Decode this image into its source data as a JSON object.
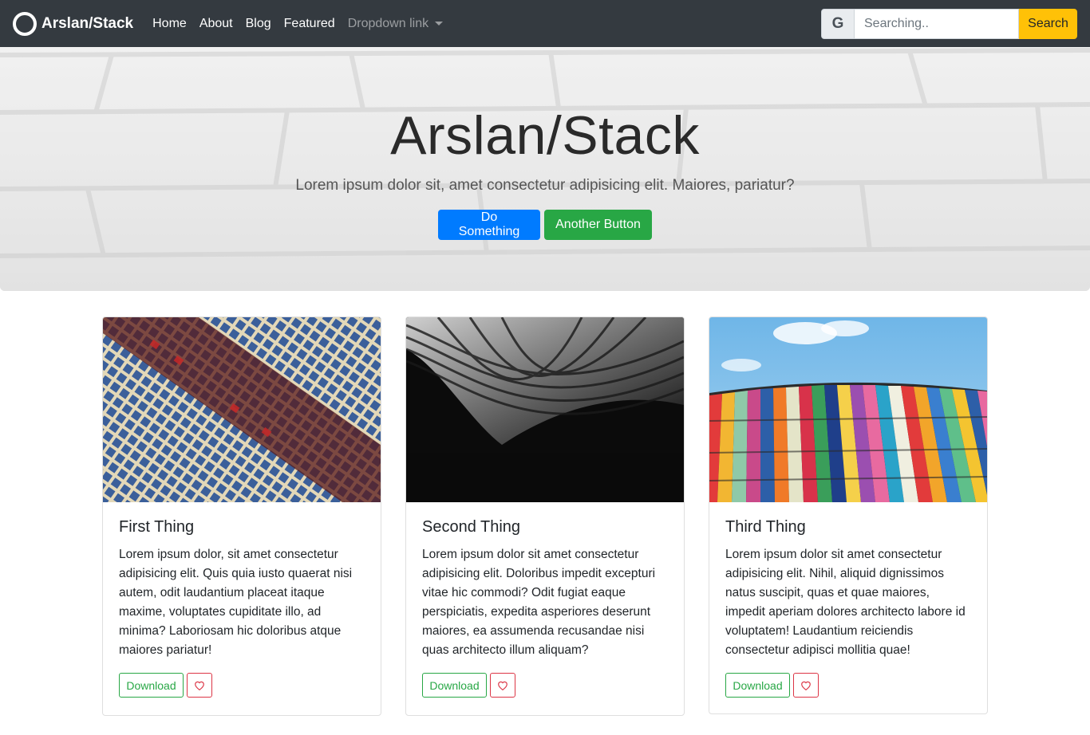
{
  "navbar": {
    "brand": "Arslan/Stack",
    "links": [
      {
        "label": "Home"
      },
      {
        "label": "About"
      },
      {
        "label": "Blog"
      },
      {
        "label": "Featured"
      },
      {
        "label": "Dropdown link"
      }
    ],
    "search_addon": "G",
    "search_placeholder": "Searching..",
    "search_button": "Search"
  },
  "hero": {
    "title": "Arslan/Stack",
    "subtitle": "Lorem ipsum dolor sit, amet consectetur adipisicing elit. Maiores, pariatur?",
    "primary_button": "Do Something",
    "secondary_button": "Another Button"
  },
  "cards": [
    {
      "title": "First Thing",
      "text": "Lorem ipsum dolor, sit amet consectetur adipisicing elit. Quis quia iusto quaerat nisi autem, odit laudantium placeat itaque maxime, voluptates cupiditate illo, ad minima? Laboriosam hic doloribus atque maiores pariatur!",
      "download": "Download"
    },
    {
      "title": "Second Thing",
      "text": "Lorem ipsum dolor sit amet consectetur adipisicing elit. Doloribus impedit excepturi vitae hic commodi? Odit fugiat eaque perspiciatis, expedita asperiores deserunt maiores, ea assumenda recusandae nisi quas architecto illum aliquam?",
      "download": "Download"
    },
    {
      "title": "Third Thing",
      "text": "Lorem ipsum dolor sit amet consectetur adipisicing elit. Nihil, aliquid dignissimos natus suscipit, quas et quae maiores, impedit aperiam dolores architecto labore id voluptatem! Laudantium reiciendis consectetur adipisci mollitia quae!",
      "download": "Download"
    }
  ],
  "colors": {
    "navbar_bg": "#343a40",
    "primary": "#007bff",
    "success": "#28a745",
    "warning": "#ffc107",
    "danger": "#dc3545"
  },
  "icons": {
    "brand": "circle-logo-icon",
    "search_addon": "google-g-icon",
    "favorite": "heart-icon",
    "dropdown": "caret-down-icon"
  }
}
